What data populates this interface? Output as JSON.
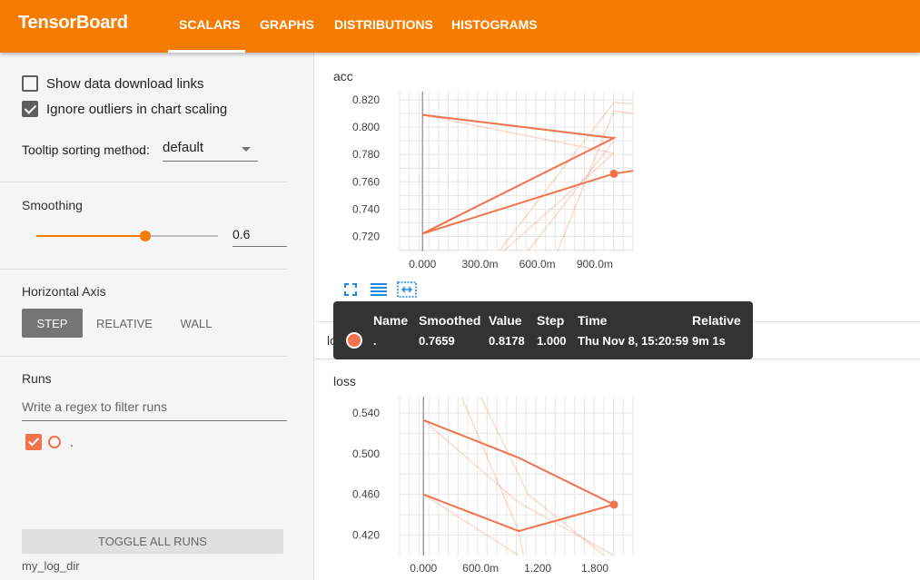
{
  "app": {
    "brand": "TensorBoard",
    "tabs": [
      {
        "label": "SCALARS",
        "active": true
      },
      {
        "label": "GRAPHS",
        "active": false
      },
      {
        "label": "DISTRIBUTIONS",
        "active": false
      },
      {
        "label": "HISTOGRAMS",
        "active": false
      }
    ],
    "accent_color": "#f57c00",
    "run_color": "#f2734b"
  },
  "sidebar": {
    "show_download_links": {
      "label": "Show data download links",
      "checked": false
    },
    "ignore_outliers": {
      "label": "Ignore outliers in chart scaling",
      "checked": true
    },
    "tooltip_sorting": {
      "label": "Tooltip sorting method:",
      "value": "default"
    },
    "smoothing": {
      "title": "Smoothing",
      "value": "0.6",
      "fraction": 0.6
    },
    "horizontal_axis": {
      "title": "Horizontal Axis",
      "options": [
        {
          "label": "STEP",
          "active": true
        },
        {
          "label": "RELATIVE",
          "active": false
        },
        {
          "label": "WALL",
          "active": false
        }
      ]
    },
    "runs": {
      "title": "Runs",
      "filter_placeholder": "Write a regex to filter runs",
      "items": [
        {
          "name": ".",
          "checked": true
        }
      ]
    },
    "toggle_all_label": "TOGGLE ALL RUNS",
    "log_dir": "my_log_dir"
  },
  "main": {
    "acc_title": "acc",
    "loss_collapsed_label": "loss",
    "loss_title": "loss",
    "icons": [
      "fullscreen-icon",
      "log-scale-icon",
      "fit-domain-icon"
    ]
  },
  "tooltip": {
    "headers": {
      "name": "Name",
      "smoothed": "Smoothed",
      "value": "Value",
      "step": "Step",
      "time": "Time",
      "relative": "Relative"
    },
    "row": {
      "name": ".",
      "smoothed": "0.7659",
      "value": "0.8178",
      "step": "1.000",
      "time": "Thu Nov 8, 15:20:59",
      "relative": "9m 1s"
    }
  },
  "chart_data": [
    {
      "type": "line",
      "title": "acc",
      "x_ticks": [
        "0.000",
        "300.0m",
        "600.0m",
        "900.0m"
      ],
      "y_ticks": [
        "0.720",
        "0.740",
        "0.760",
        "0.780",
        "0.800",
        "0.820"
      ],
      "xlim": [
        -0.12,
        1.1
      ],
      "ylim": [
        0.709,
        0.826
      ],
      "grid": true,
      "series": [
        {
          "style": "smoothed",
          "x": [
            0,
            1,
            0,
            1,
            1.1
          ],
          "y": [
            0.809,
            0.792,
            0.722,
            0.766,
            0.768
          ]
        },
        {
          "style": "raw",
          "x": [
            0,
            1,
            0.35,
            1,
            1.1
          ],
          "y": [
            0.809,
            0.781,
            0.7,
            0.818,
            0.817
          ]
        },
        {
          "style": "raw",
          "x": [
            0.5,
            1
          ],
          "y": [
            0.7,
            0.79
          ]
        },
        {
          "style": "raw",
          "x": [
            0.68,
            1,
            1.1
          ],
          "y": [
            0.7,
            0.812,
            0.81
          ]
        }
      ],
      "highlight": {
        "x": 1,
        "y": 0.7659
      }
    },
    {
      "type": "line",
      "title": "loss",
      "x_ticks": [
        "0.000",
        "600.0m",
        "1.200",
        "1.800"
      ],
      "y_ticks": [
        "0.420",
        "0.460",
        "0.500",
        "0.540"
      ],
      "xlim": [
        -0.25,
        2.2
      ],
      "ylim": [
        0.4,
        0.556
      ],
      "grid": true,
      "series": [
        {
          "style": "smoothed",
          "x": [
            0,
            1,
            2,
            1,
            0,
            1
          ],
          "y": [
            0.533,
            0.496,
            0.45,
            0.424,
            0.46,
            0.424
          ]
        },
        {
          "style": "raw",
          "x": [
            0,
            1,
            2
          ],
          "y": [
            0.533,
            0.452,
            0.4
          ]
        },
        {
          "style": "raw",
          "x": [
            0.4,
            1,
            1.05
          ],
          "y": [
            0.556,
            0.424,
            0.4
          ]
        },
        {
          "style": "raw",
          "x": [
            0.6,
            1.1,
            1.9
          ],
          "y": [
            0.556,
            0.46,
            0.4
          ]
        },
        {
          "style": "raw",
          "x": [
            0,
            1
          ],
          "y": [
            0.46,
            0.4
          ]
        }
      ],
      "highlight": {
        "x": 2,
        "y": 0.45
      }
    }
  ]
}
